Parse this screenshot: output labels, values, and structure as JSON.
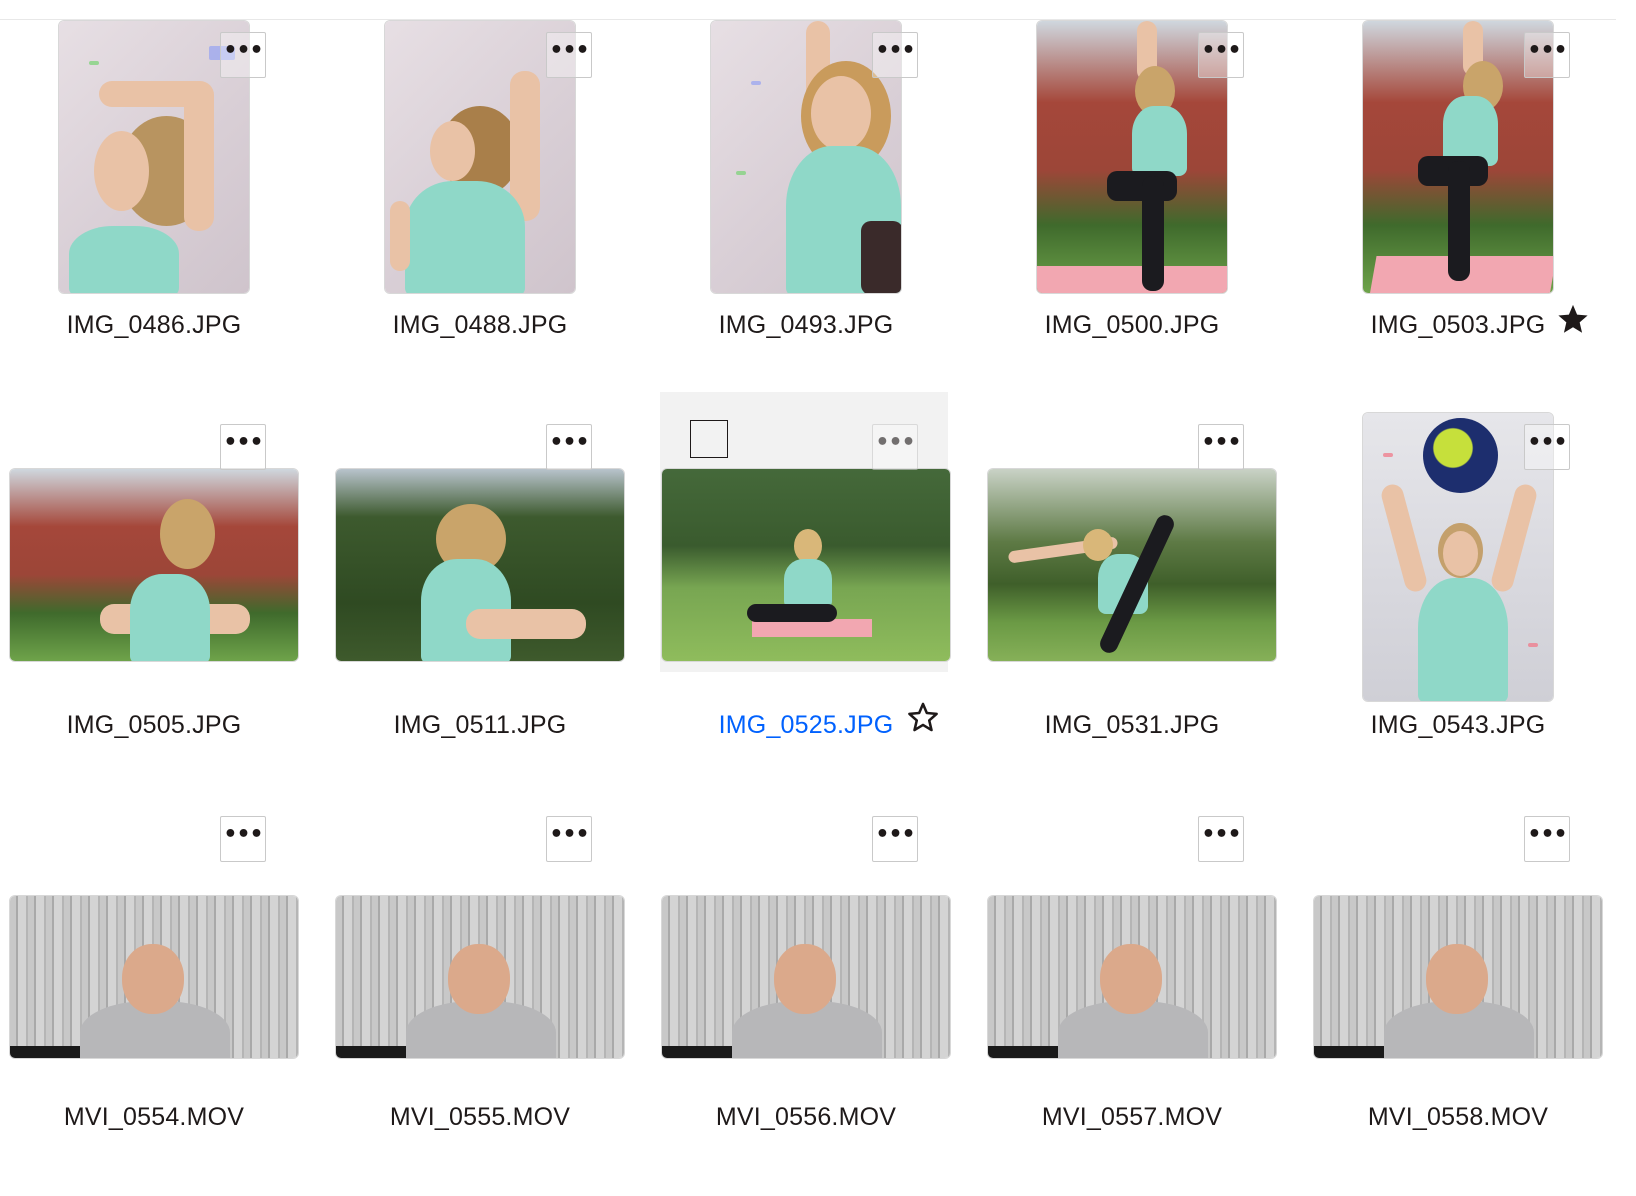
{
  "colors": {
    "text": "#1e1919",
    "accent_link": "#0061fe",
    "selection_bg": "#f2f2f2",
    "border": "#d8d8d8"
  },
  "actions": {
    "more_label": "•••",
    "star_icon": "star-icon",
    "star_outline_icon": "star-outline-icon"
  },
  "files": [
    {
      "name": "IMG_0486.JPG",
      "type": "image",
      "orientation": "portrait",
      "starred": false,
      "selected": false
    },
    {
      "name": "IMG_0488.JPG",
      "type": "image",
      "orientation": "portrait",
      "starred": false,
      "selected": false
    },
    {
      "name": "IMG_0493.JPG",
      "type": "image",
      "orientation": "portrait",
      "starred": false,
      "selected": false
    },
    {
      "name": "IMG_0500.JPG",
      "type": "image",
      "orientation": "portrait",
      "starred": false,
      "selected": false
    },
    {
      "name": "IMG_0503.JPG",
      "type": "image",
      "orientation": "portrait",
      "starred": true,
      "selected": false
    },
    {
      "name": "IMG_0505.JPG",
      "type": "image",
      "orientation": "landscape",
      "starred": false,
      "selected": false
    },
    {
      "name": "IMG_0511.JPG",
      "type": "image",
      "orientation": "landscape",
      "starred": false,
      "selected": false
    },
    {
      "name": "IMG_0525.JPG",
      "type": "image",
      "orientation": "landscape",
      "starred": false,
      "selected": true
    },
    {
      "name": "IMG_0531.JPG",
      "type": "image",
      "orientation": "landscape",
      "starred": false,
      "selected": false
    },
    {
      "name": "IMG_0543.JPG",
      "type": "image",
      "orientation": "portrait",
      "starred": false,
      "selected": false
    },
    {
      "name": "MVI_0554.MOV",
      "type": "video",
      "orientation": "landscape",
      "starred": false,
      "selected": false
    },
    {
      "name": "MVI_0555.MOV",
      "type": "video",
      "orientation": "landscape",
      "starred": false,
      "selected": false
    },
    {
      "name": "MVI_0556.MOV",
      "type": "video",
      "orientation": "landscape",
      "starred": false,
      "selected": false
    },
    {
      "name": "MVI_0557.MOV",
      "type": "video",
      "orientation": "landscape",
      "starred": false,
      "selected": false
    },
    {
      "name": "MVI_0558.MOV",
      "type": "video",
      "orientation": "landscape",
      "starred": false,
      "selected": false
    }
  ]
}
